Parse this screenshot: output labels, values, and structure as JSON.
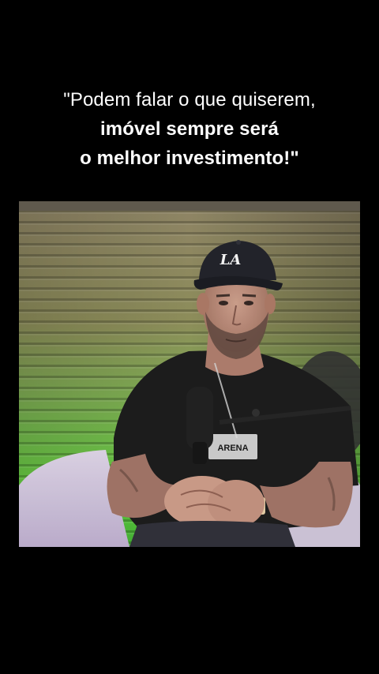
{
  "caption": {
    "line1": "\"Podem falar o que quiserem,",
    "line2": "imóvel sempre será",
    "line3": "o melhor investimento!\""
  },
  "video": {
    "cap_logo": "LA",
    "shirt_text": "ARENA"
  },
  "colors": {
    "background": "#000000",
    "caption_text": "#ffffff",
    "wall_top": "#8a7f5a",
    "wall_bottom": "#6fd444",
    "shirt": "#141414",
    "cap": "#1b1c24",
    "skin": "#b98a78"
  }
}
